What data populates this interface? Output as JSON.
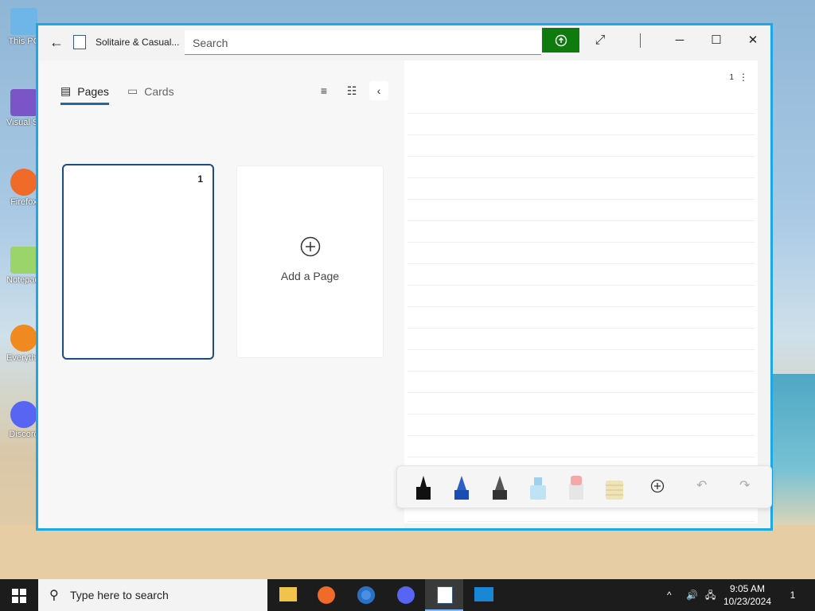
{
  "desktop": {
    "icons": [
      {
        "label": "This PC"
      },
      {
        "label": "Visual Studio 2019"
      },
      {
        "label": "Firefox"
      },
      {
        "label": "Notepad++"
      },
      {
        "label": "Everything"
      },
      {
        "label": "Discord"
      }
    ]
  },
  "window": {
    "app_title": "Solitaire & Casual...",
    "search_placeholder": "Search",
    "controls": {
      "minimize": "─",
      "maximize": "☐",
      "close": "✕"
    }
  },
  "left_pane": {
    "tabs": [
      {
        "label": "Pages",
        "active": true
      },
      {
        "label": "Cards",
        "active": false
      }
    ],
    "pages": [
      {
        "number": "1"
      }
    ],
    "add_page_label": "Add a Page"
  },
  "right_pane": {
    "page_number": "1",
    "more_icon": "⋮"
  },
  "ink_toolbar": {
    "tools": [
      "pen-black",
      "pen-blue",
      "pencil",
      "highlighter",
      "eraser",
      "ruler"
    ],
    "add_icon": "plus-circle",
    "undo_icon": "undo",
    "redo_icon": "redo"
  },
  "taskbar": {
    "search_placeholder": "Type here to search",
    "pinned": [
      "file-explorer",
      "firefox",
      "chrome",
      "discord",
      "journal-app",
      "remote-desktop"
    ],
    "time": "9:05 AM",
    "date": "10/23/2024",
    "notifications_count": "1"
  },
  "colors": {
    "accent": "#1f6aa5",
    "sync_green": "#0f7b0f",
    "window_border": "#1ca7e6"
  }
}
